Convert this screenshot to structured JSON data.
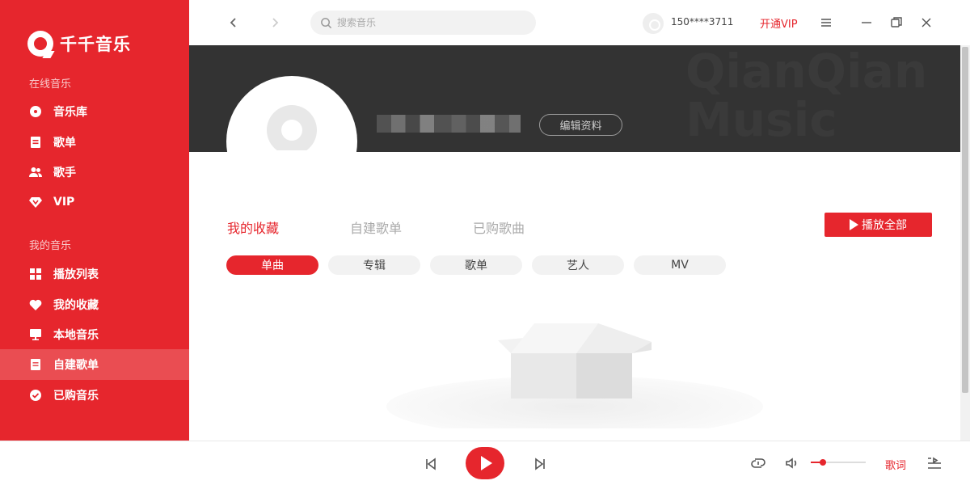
{
  "app": {
    "name": "千千音乐"
  },
  "sidebar": {
    "online_title": "在线音乐",
    "online_items": [
      {
        "label": "音乐库",
        "icon": "disc-icon"
      },
      {
        "label": "歌单",
        "icon": "playlist-icon"
      },
      {
        "label": "歌手",
        "icon": "singer-icon"
      },
      {
        "label": "VIP",
        "icon": "diamond-icon"
      }
    ],
    "mine_title": "我的音乐",
    "mine_items": [
      {
        "label": "播放列表",
        "icon": "grid-icon"
      },
      {
        "label": "我的收藏",
        "icon": "heart-icon"
      },
      {
        "label": "本地音乐",
        "icon": "monitor-icon"
      },
      {
        "label": "自建歌单",
        "icon": "playlist-icon",
        "active": true
      },
      {
        "label": "已购音乐",
        "icon": "check-circle-icon"
      }
    ]
  },
  "topbar": {
    "search_placeholder": "搜索音乐",
    "user_phone": "150****3711",
    "vip_label": "开通VIP"
  },
  "banner": {
    "watermark_line1": "QianQian",
    "watermark_line2": "Music",
    "edit_profile": "编辑资料"
  },
  "tabs": [
    {
      "label": "我的收藏",
      "active": true
    },
    {
      "label": "自建歌单",
      "active": false
    },
    {
      "label": "已购歌曲",
      "active": false
    }
  ],
  "play_all_label": "播放全部",
  "filters": [
    {
      "label": "单曲",
      "active": true
    },
    {
      "label": "专辑",
      "active": false
    },
    {
      "label": "歌单",
      "active": false
    },
    {
      "label": "艺人",
      "active": false
    },
    {
      "label": "MV",
      "active": false
    }
  ],
  "player": {
    "lyrics_label": "歌词",
    "volume": 0.22
  },
  "colors": {
    "accent": "#e6262d",
    "banner": "#333333"
  }
}
